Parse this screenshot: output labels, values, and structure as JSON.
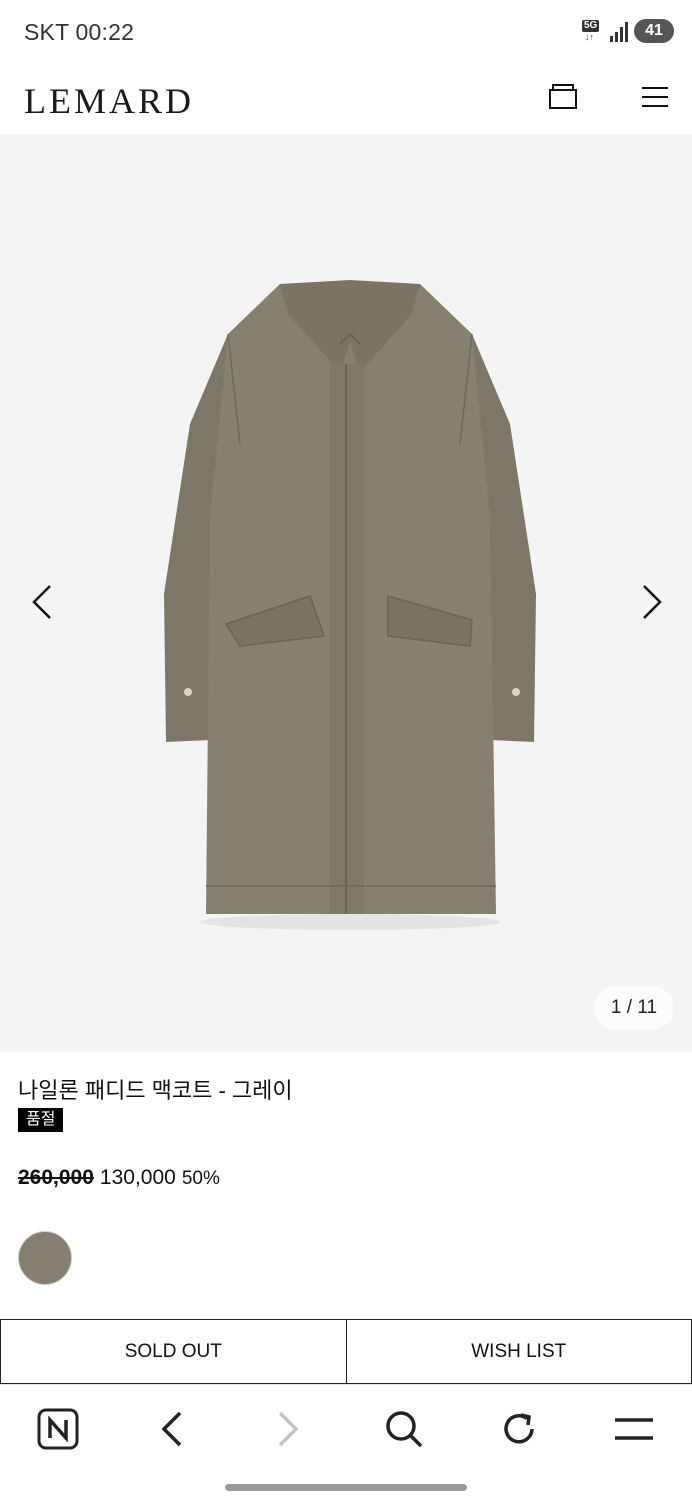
{
  "status_bar": {
    "carrier_time": "SKT 00:22",
    "network": "5G",
    "battery": "41"
  },
  "header": {
    "logo": "LEMARD"
  },
  "gallery": {
    "page_indicator": "1 / 11"
  },
  "product": {
    "name": "나일론 패디드 맥코트 - 그레이",
    "badge": "품절",
    "price_original": "260,000",
    "price_sale": "130,000",
    "discount": "50%",
    "swatch_color": "#857f72"
  },
  "actions": {
    "sold_out": "SOLD OUT",
    "wish_list": "WISH LIST"
  },
  "icons": {
    "cart": "shopping-bag-icon",
    "menu": "hamburger-menu-icon",
    "prev": "chevron-left-icon",
    "next": "chevron-right-icon",
    "naver": "naver-n-icon",
    "back": "back-icon",
    "forward": "forward-icon",
    "search": "search-icon",
    "refresh": "refresh-icon",
    "browser_menu": "browser-menu-icon"
  }
}
